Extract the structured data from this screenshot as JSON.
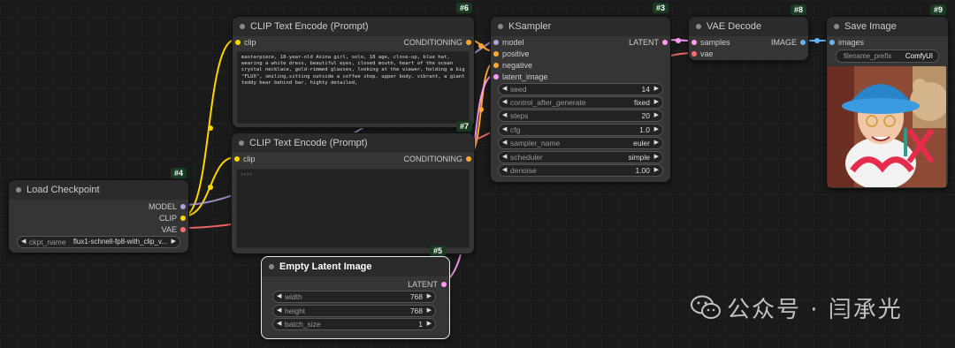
{
  "nodes": {
    "clip_pos": {
      "id": "#6",
      "title": "CLIP Text Encode (Prompt)",
      "input_clip": "clip",
      "output": "CONDITIONING",
      "text": "masterpiece, 18-year-old Asina girl, solo, 18 age, close-up, blue hat, wearing a white dress, beautiful eyes, closed mouth, heart of the ocean crystal necklace, gold-rimmed glasses, looking at the viewer, holding a big \"FLUX\", smiling,sitting outside a coffee shop, upper body, vibrant, a giant teddy bear behind bar, highty detailed,"
    },
    "clip_neg": {
      "id": "#7",
      "title": "CLIP Text Encode (Prompt)",
      "input_clip": "clip",
      "output": "CONDITIONING",
      "placeholder": "text"
    },
    "ksampler": {
      "id": "#3",
      "title": "KSampler",
      "inputs": [
        "model",
        "positive",
        "negative",
        "latent_image"
      ],
      "output": "LATENT",
      "widgets": [
        {
          "label": "seed",
          "value": "14"
        },
        {
          "label": "control_after_generate",
          "value": "fixed"
        },
        {
          "label": "steps",
          "value": "20"
        },
        {
          "label": "cfg",
          "value": "1.0"
        },
        {
          "label": "sampler_name",
          "value": "euler"
        },
        {
          "label": "scheduler",
          "value": "simple"
        },
        {
          "label": "denoise",
          "value": "1.00"
        }
      ]
    },
    "vae_decode": {
      "id": "#8",
      "title": "VAE Decode",
      "inputs": [
        "samples",
        "vae"
      ],
      "output": "IMAGE"
    },
    "save_image": {
      "id": "#9",
      "title": "Save Image",
      "input": "images",
      "prefix_label": "filename_prefix",
      "prefix_value": "ComfyUI"
    },
    "load_checkpoint": {
      "id": "#4",
      "title": "Load Checkpoint",
      "outputs": [
        "MODEL",
        "CLIP",
        "VAE"
      ],
      "ckpt_label": "ckpt_name",
      "ckpt_value": "flux1-schnell-fp8-with_clip_v..."
    },
    "empty_latent": {
      "id": "#5",
      "title": "Empty Latent Image",
      "output": "LATENT",
      "widgets": [
        {
          "label": "width",
          "value": "768"
        },
        {
          "label": "height",
          "value": "768"
        },
        {
          "label": "batch_size",
          "value": "1"
        }
      ]
    }
  },
  "colors": {
    "background": "#1a1a1a",
    "node_body": "#353535",
    "node_header": "#2b2b2b",
    "clip": "#ffd500",
    "conditioning": "#ffa931",
    "model": "#b39ddb",
    "vae": "#ff6e6e",
    "latent": "#ff9cf9",
    "image": "#64b5f6",
    "id_badge": "#183b22"
  },
  "watermark": {
    "text": "公众号 · 闫承光",
    "icon": "wechat-icon"
  }
}
